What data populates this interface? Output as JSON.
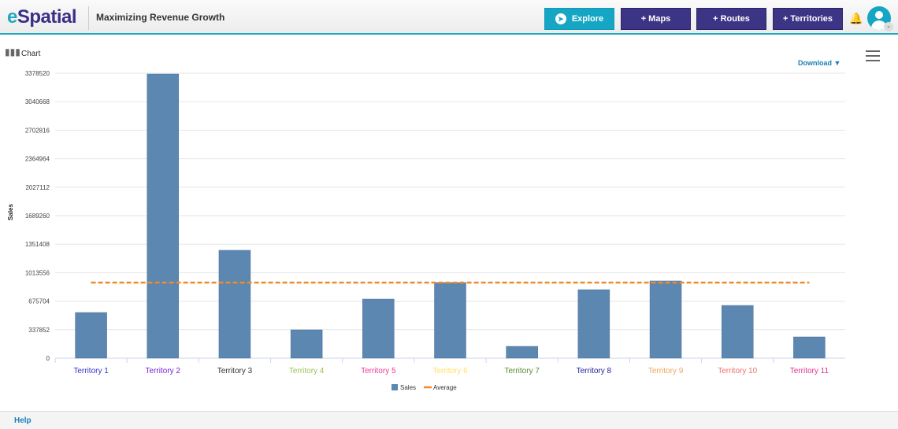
{
  "header": {
    "logo": "eSpatial",
    "title": "Maximizing Revenue Growth",
    "buttons": {
      "explore": "Explore",
      "maps": "+ Maps",
      "routes": "+ Routes",
      "territories": "+ Territories"
    },
    "icons": [
      "compass-icon",
      "bell-icon",
      "user-avatar-icon",
      "chevron-down-icon"
    ]
  },
  "panel": {
    "label": "Chart",
    "download": "Download ▼"
  },
  "footer": {
    "help": "Help"
  },
  "chart_data": {
    "type": "bar",
    "ylabel": "Sales",
    "ylim": [
      0,
      3378520
    ],
    "yticks": [
      "0",
      "337852",
      "675704",
      "1013556",
      "1351408",
      "1689260",
      "2027112",
      "2364964",
      "2702816",
      "3040668",
      "3378520"
    ],
    "categories": [
      "Territory 1",
      "Territory 2",
      "Territory 3",
      "Territory 4",
      "Territory 5",
      "Territory 6",
      "Territory 7",
      "Territory 8",
      "Territory 9",
      "Territory 10",
      "Territory 11"
    ],
    "category_colors": [
      "#3333cc",
      "#7a22d6",
      "#333333",
      "#99c25a",
      "#e6399b",
      "#ffe066",
      "#5f8a2e",
      "#22229a",
      "#f4a460",
      "#f07070",
      "#e0358a"
    ],
    "series": [
      {
        "name": "Sales",
        "type": "bar",
        "color": "#5b87b0",
        "values": [
          541000,
          3369000,
          1279000,
          336000,
          700000,
          896000,
          140000,
          812000,
          915000,
          625000,
          252000
        ]
      },
      {
        "name": "Average",
        "type": "line",
        "color": "#f08a2c",
        "dashed": true,
        "value": 896000
      }
    ],
    "grid": true,
    "legend": "bottom"
  }
}
